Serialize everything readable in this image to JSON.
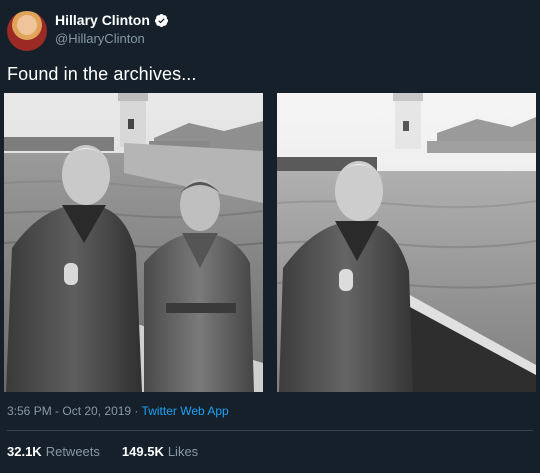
{
  "user": {
    "display_name": "Hillary Clinton",
    "handle": "@HillaryClinton"
  },
  "tweet": {
    "text": "Found in the archives...",
    "time": "3:56 PM",
    "separator": " - ",
    "date": "Oct 20, 2019",
    "dot": " · ",
    "source": "Twitter Web App"
  },
  "stats": {
    "retweets_count": "32.1K",
    "retweets_label": "Retweets",
    "likes_count": "149.5K",
    "likes_label": "Likes"
  },
  "icons": {
    "verified": "verified-badge-icon"
  },
  "colors": {
    "background": "#15202b",
    "muted_text": "#8899a6",
    "link": "#1da1f2",
    "divider": "#38444d"
  }
}
